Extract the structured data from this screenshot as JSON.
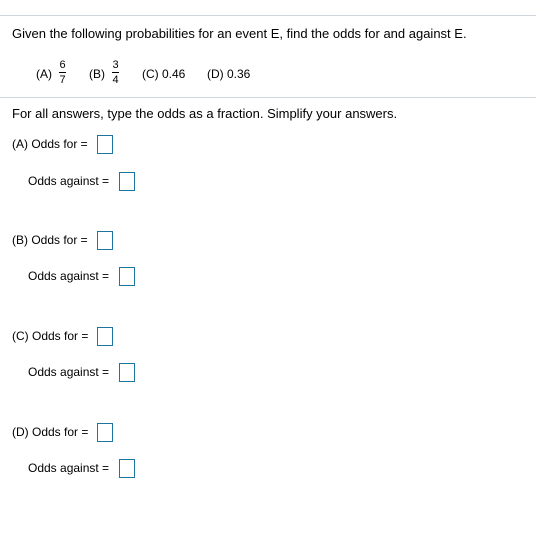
{
  "question": "Given the following probabilities for an event E, find the odds for and against E.",
  "options": [
    {
      "label": "(A)",
      "numerator": "6",
      "denominator": "7"
    },
    {
      "label": "(B)",
      "numerator": "3",
      "denominator": "4"
    },
    {
      "label": "(C) 0.46"
    },
    {
      "label": "(D) 0.36"
    }
  ],
  "instruction": "For all answers, type the odds as a fraction. Simplify your answers.",
  "answers": [
    {
      "for_label": "(A) Odds for =",
      "against_label": "Odds against =",
      "for_value": "",
      "against_value": ""
    },
    {
      "for_label": "(B) Odds for =",
      "against_label": "Odds against =",
      "for_value": "",
      "against_value": ""
    },
    {
      "for_label": "(C) Odds for =",
      "against_label": "Odds against =",
      "for_value": "",
      "against_value": ""
    },
    {
      "for_label": "(D) Odds for =",
      "against_label": "Odds against =",
      "for_value": "",
      "against_value": ""
    }
  ]
}
